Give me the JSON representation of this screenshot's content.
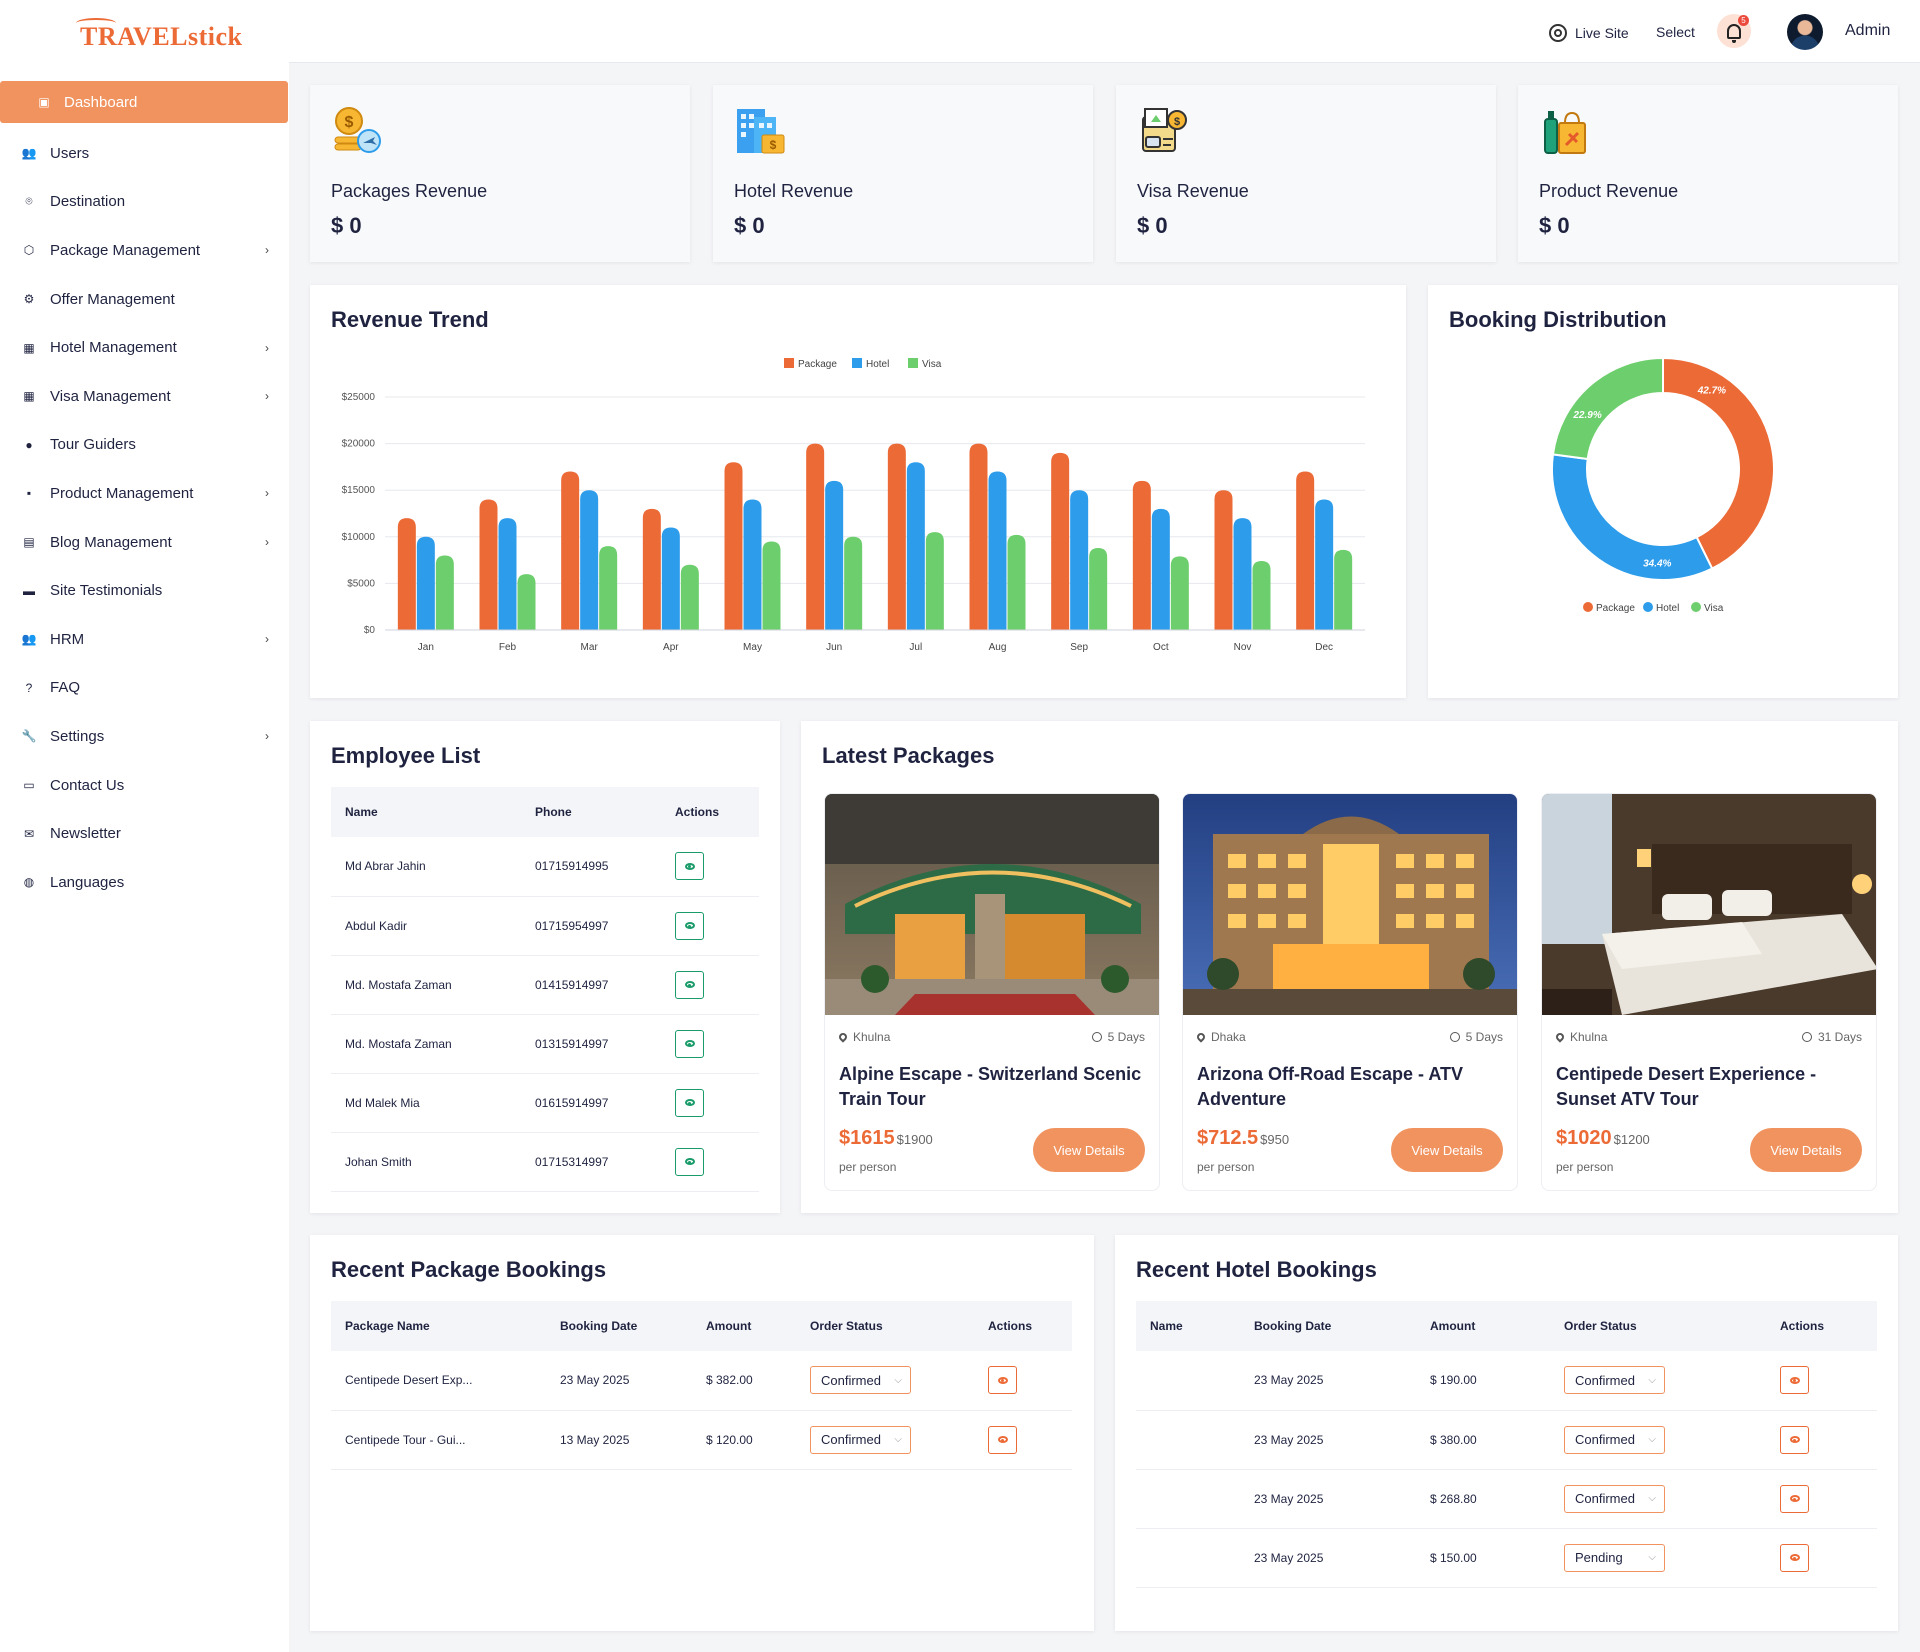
{
  "brand": {
    "logo_text": "TRAVELstick"
  },
  "sidebar": {
    "items": [
      {
        "label": "Dashboard",
        "icon": "dashboard-icon",
        "active": true,
        "has_chevron": false
      },
      {
        "label": "Users",
        "icon": "users-icon",
        "has_chevron": false
      },
      {
        "label": "Destination",
        "icon": "location-icon",
        "has_chevron": false
      },
      {
        "label": "Package Management",
        "icon": "cube-icon",
        "has_chevron": true
      },
      {
        "label": "Offer Management",
        "icon": "gear-icon",
        "has_chevron": false
      },
      {
        "label": "Hotel Management",
        "icon": "building-icon",
        "has_chevron": true
      },
      {
        "label": "Visa Management",
        "icon": "building-icon",
        "has_chevron": true
      },
      {
        "label": "Tour Guiders",
        "icon": "user-icon",
        "has_chevron": false
      },
      {
        "label": "Product Management",
        "icon": "grid-icon",
        "has_chevron": true
      },
      {
        "label": "Blog Management",
        "icon": "blog-icon",
        "has_chevron": true
      },
      {
        "label": "Site Testimonials",
        "icon": "comment-icon",
        "has_chevron": false
      },
      {
        "label": "HRM",
        "icon": "users-icon",
        "has_chevron": true
      },
      {
        "label": "FAQ",
        "icon": "question-icon",
        "has_chevron": false
      },
      {
        "label": "Settings",
        "icon": "wrench-icon",
        "has_chevron": true
      },
      {
        "label": "Contact Us",
        "icon": "contact-card-icon",
        "has_chevron": false
      },
      {
        "label": "Newsletter",
        "icon": "mail-icon",
        "has_chevron": false
      },
      {
        "label": "Languages",
        "icon": "globe-icon",
        "has_chevron": false
      }
    ]
  },
  "header": {
    "live_site": "Live Site",
    "select": "Select",
    "notification_count": "5",
    "user": "Admin"
  },
  "stats": [
    {
      "label": "Packages Revenue",
      "value": "$ 0",
      "icon": "coins-plane-icon"
    },
    {
      "label": "Hotel Revenue",
      "value": "$ 0",
      "icon": "hotel-building-icon"
    },
    {
      "label": "Visa Revenue",
      "value": "$ 0",
      "icon": "visa-passport-icon"
    },
    {
      "label": "Product Revenue",
      "value": "$ 0",
      "icon": "product-bag-icon"
    }
  ],
  "revenue_trend": {
    "title": "Revenue Trend",
    "chart_data": {
      "type": "bar",
      "categories": [
        "Jan",
        "Feb",
        "Mar",
        "Apr",
        "May",
        "Jun",
        "Jul",
        "Aug",
        "Sep",
        "Oct",
        "Nov",
        "Dec"
      ],
      "series": [
        {
          "name": "Package",
          "color": "#ec6a36",
          "values": [
            12000,
            14000,
            17000,
            13000,
            18000,
            20000,
            20000,
            20000,
            19000,
            16000,
            15000,
            17000
          ]
        },
        {
          "name": "Hotel",
          "color": "#2d9cea",
          "values": [
            10000,
            12000,
            15000,
            11000,
            14000,
            16000,
            18000,
            17000,
            15000,
            13000,
            12000,
            14000
          ]
        },
        {
          "name": "Visa",
          "color": "#6cce6c",
          "values": [
            8000,
            6000,
            9000,
            7000,
            9500,
            10000,
            10500,
            10200,
            8800,
            7900,
            7400,
            8600
          ]
        }
      ],
      "ylim": [
        0,
        25000
      ],
      "yticks": [
        "$0",
        "$5000",
        "$10000",
        "$15000",
        "$20000",
        "$25000"
      ],
      "grid": true,
      "legend": "top"
    }
  },
  "booking_distribution": {
    "title": "Booking Distribution",
    "chart_data": {
      "type": "pie",
      "labels": [
        "Package",
        "Hotel",
        "Visa"
      ],
      "values": [
        42.7,
        34.4,
        22.9
      ],
      "value_labels": [
        "42.7%",
        "34.4%",
        "22.9%"
      ],
      "colors": [
        "#ec6a36",
        "#2d9cea",
        "#6cce6c"
      ],
      "legend": "bottom"
    }
  },
  "employees": {
    "title": "Employee List",
    "columns": [
      "Name",
      "Phone",
      "Actions"
    ],
    "rows": [
      {
        "name": "Md Abrar Jahin",
        "phone": "01715914995"
      },
      {
        "name": "Abdul Kadir",
        "phone": "01715954997"
      },
      {
        "name": "Md. Mostafa Zaman",
        "phone": "01415914997"
      },
      {
        "name": "Md. Mostafa Zaman",
        "phone": "01315914997"
      },
      {
        "name": "Md Malek Mia",
        "phone": "01615914997"
      },
      {
        "name": "Johan Smith",
        "phone": "01715314997"
      }
    ]
  },
  "latest_packages": {
    "title": "Latest Packages",
    "items": [
      {
        "location": "Khulna",
        "days": "5 Days",
        "name": "Alpine Escape - Switzerland Scenic Train Tour",
        "price": "$1615",
        "old_price": "$1900",
        "per": "per person",
        "button": "View Details"
      },
      {
        "location": "Dhaka",
        "days": "5 Days",
        "name": "Arizona Off-Road Escape - ATV Adventure",
        "price": "$712.5",
        "old_price": "$950",
        "per": "per person",
        "button": "View Details"
      },
      {
        "location": "Khulna",
        "days": "31 Days",
        "name": "Centipede Desert Experience - Sunset ATV Tour",
        "price": "$1020",
        "old_price": "$1200",
        "per": "per person",
        "button": "View Details"
      }
    ]
  },
  "package_bookings": {
    "title": "Recent Package Bookings",
    "columns": [
      "Package Name",
      "Booking Date",
      "Amount",
      "Order Status",
      "Actions"
    ],
    "rows": [
      {
        "name": "Centipede Desert Exp...",
        "date": "23 May 2025",
        "amount": "$ 382.00",
        "status": "Confirmed"
      },
      {
        "name": "Centipede Tour - Gui...",
        "date": "13 May 2025",
        "amount": "$ 120.00",
        "status": "Confirmed"
      }
    ]
  },
  "hotel_bookings": {
    "title": "Recent Hotel Bookings",
    "columns": [
      "Name",
      "Booking Date",
      "Amount",
      "Order Status",
      "Actions"
    ],
    "rows": [
      {
        "name": "",
        "date": "23 May 2025",
        "amount": "$ 190.00",
        "status": "Confirmed"
      },
      {
        "name": "",
        "date": "23 May 2025",
        "amount": "$ 380.00",
        "status": "Confirmed"
      },
      {
        "name": "",
        "date": "23 May 2025",
        "amount": "$ 268.80",
        "status": "Confirmed"
      },
      {
        "name": "",
        "date": "23 May 2025",
        "amount": "$ 150.00",
        "status": "Pending"
      }
    ]
  }
}
